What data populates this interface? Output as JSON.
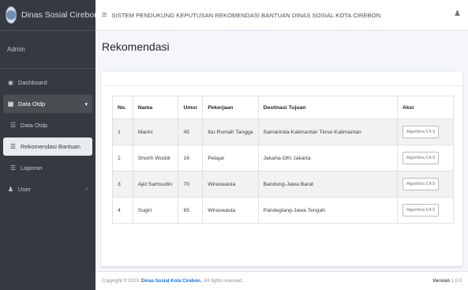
{
  "brand": {
    "name": "Dinas Sosial Cirebon"
  },
  "user_panel": {
    "name": "Admin"
  },
  "sidebar": {
    "items": [
      {
        "label": "Dashboard",
        "icon": "dashboard-icon"
      },
      {
        "label": "Data Otdp",
        "icon": "table-icon"
      },
      {
        "label": "Data Otdp",
        "icon": "list-icon"
      },
      {
        "label": "Rekomendasi Bantuan",
        "icon": "list-icon"
      },
      {
        "label": "Laporan",
        "icon": "list-icon"
      },
      {
        "label": "User",
        "icon": "user-icon"
      }
    ]
  },
  "topbar": {
    "title": "SISTEM PENDUKUNG KEPUTUSAN REKOMENDASI BANTUAN DINAS SOSIAL KOTA CIREBON"
  },
  "page": {
    "title": "Rekomendasi"
  },
  "table": {
    "headers": [
      "No.",
      "Nama",
      "Umur",
      "Pekerjaan",
      "Destinasi Tujuan",
      "Aksi"
    ],
    "rows": [
      {
        "no": "1",
        "nama": "Marini",
        "umur": "45",
        "pekerjaan": "Ibu Rumah Tangga",
        "destinasi": "Samarinda-Kalimantan Timur-Kalimantan",
        "aksi": "Algoritma C4.5"
      },
      {
        "no": "2",
        "nama": "Shorih Wuddi",
        "umur": "16",
        "pekerjaan": "Pelajar",
        "destinasi": "Jakarta-DKI Jakarta",
        "aksi": "Algoritma C4.5"
      },
      {
        "no": "3",
        "nama": "Ajid Samsudin",
        "umur": "70",
        "pekerjaan": "Wiraswasta",
        "destinasi": "Bandung-Jawa Barat",
        "aksi": "Algoritma C4.5"
      },
      {
        "no": "4",
        "nama": "Sugiri",
        "umur": "65",
        "pekerjaan": "Wiraswasta",
        "destinasi": "Pandeglang-Jawa Tengah",
        "aksi": "Algoritma C4.5"
      }
    ]
  },
  "footer": {
    "copyright": "Copyright © 2023",
    "org": "Dinas Sosial Kota Cirebon.",
    "rights": "All rights reserved.",
    "version_label": "Version",
    "version_value": "1.0.0"
  }
}
